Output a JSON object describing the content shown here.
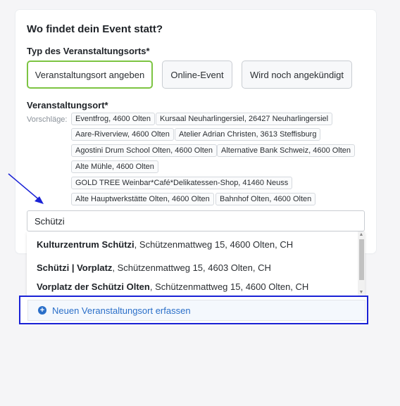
{
  "section": {
    "heading": "Wo findet dein Event statt?",
    "type_label": "Typ des Veranstaltungsorts*",
    "type_buttons": [
      "Veranstaltungsort angeben",
      "Online-Event",
      "Wird noch angekündigt"
    ],
    "selected_type": "Veranstaltungsort angeben",
    "venue_label": "Veranstaltungsort*",
    "suggestions_label": "Vorschläge:",
    "suggestions": [
      "Eventfrog, 4600 Olten",
      "Kursaal Neuharlingersiel, 26427 Neuharlingersiel",
      "Aare-Riverview, 4600 Olten",
      "Atelier Adrian Christen, 3613 Steffisburg",
      "Agostini Drum School Olten, 4600 Olten",
      "Alternative Bank Schweiz, 4600 Olten",
      "Alte Mühle, 4600 Olten",
      "GOLD TREE Weinbar*Café*Delikatessen-Shop, 41460 Neuss",
      "Alte Hauptwerkstätte Olten, 4600 Olten",
      "Bahnhof Olten, 4600 Olten"
    ]
  },
  "search": {
    "value": "Schützi"
  },
  "results": [
    {
      "name": "Kulturzentrum Schützi",
      "address": ", Schützenmattweg 15, 4600 Olten, CH"
    },
    {
      "name": "Schützi | Vorplatz",
      "address": ", Schützenmattweg 15, 4603 Olten, CH"
    },
    {
      "name": "Vorplatz der Schützi Olten",
      "address": ", Schützenmattweg 15, 4600 Olten, CH"
    }
  ],
  "new_venue": {
    "label": "Neuen Veranstaltungsort erfassen"
  },
  "colors": {
    "accent_green": "#7cc442",
    "link_blue": "#2a6fc9",
    "highlight_box": "#1a22d6",
    "annotation_arrow": "#1a22d6"
  },
  "icons": {
    "new_venue": "plus-circle-icon",
    "annotation": "arrow-icon"
  }
}
